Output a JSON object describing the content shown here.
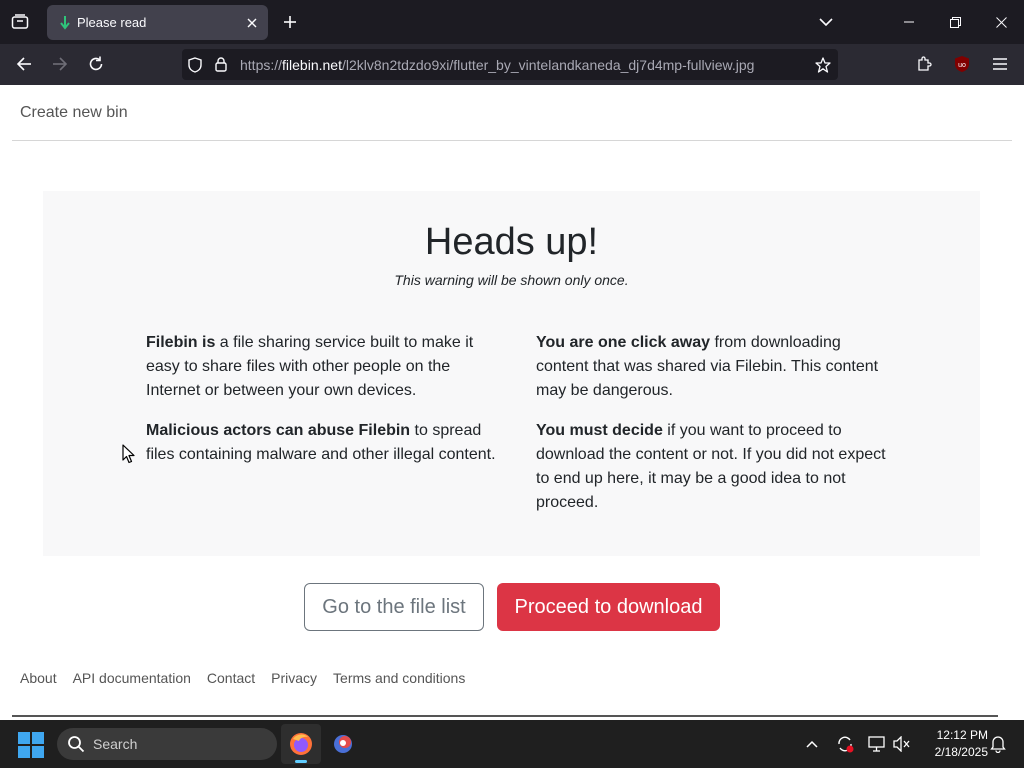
{
  "browser": {
    "tab_title": "Please read",
    "url_prefix": "https://",
    "url_host": "filebin.net",
    "url_path": "/l2klv8n2tdzdo9xi/flutter_by_vintelandkaneda_dj7d4mp-fullview.jpg"
  },
  "page": {
    "create_link": "Create new bin",
    "heading": "Heads up!",
    "subheading": "This warning will be shown only once.",
    "left": [
      {
        "bold": "Filebin is",
        "text": " a file sharing service built to make it easy to share files with other people on the Internet or between your own devices."
      },
      {
        "bold": "Malicious actors can abuse Filebin",
        "text": " to spread files containing malware and other illegal content."
      }
    ],
    "right": [
      {
        "bold": "You are one click away",
        "text": " from downloading content that was shared via Filebin. This content may be dangerous."
      },
      {
        "bold": "You must decide",
        "text": " if you want to proceed to download the content or not. If you did not expect to end up here, it may be a good idea to not proceed."
      }
    ],
    "btn_file_list": "Go to the file list",
    "btn_proceed": "Proceed to download",
    "footer": [
      "About",
      "API documentation",
      "Contact",
      "Privacy",
      "Terms and conditions"
    ]
  },
  "taskbar": {
    "search_label": "Search",
    "time": "12:12 PM",
    "date": "2/18/2025"
  },
  "colors": {
    "danger": "#dc3545",
    "chrome_dark": "#1c1b22",
    "chrome_nav": "#2b2a33"
  }
}
